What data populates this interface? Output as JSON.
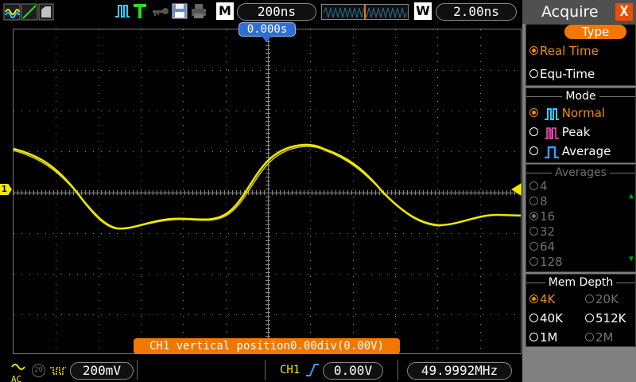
{
  "topbar": {
    "timebase": "200ns",
    "main_label": "M",
    "window_label": "W",
    "window_time": "2.00ns"
  },
  "screen": {
    "trigger_position": "0.000s",
    "ch1_marker": "1",
    "status_message": "CH1 vertical position0.00div(0.00V)",
    "grid": true,
    "colors": {
      "trace": "#f0e800",
      "grid": "#888888",
      "accent": "#f07800"
    }
  },
  "bottombar": {
    "coupling": "AC",
    "bw_limit": "20",
    "volts_div": "200mV",
    "trigger_source": "CH1",
    "trigger_level": "0.00V",
    "frequency": "49.9992MHz"
  },
  "menu": {
    "title": "Acquire",
    "close": "X",
    "type": {
      "title": "Type",
      "options": [
        {
          "label": "Real Time",
          "selected": true
        },
        {
          "label": "Equ-Time",
          "selected": false
        }
      ]
    },
    "mode": {
      "title": "Mode",
      "options": [
        {
          "label": "Normal",
          "selected": true
        },
        {
          "label": "Peak",
          "selected": false
        },
        {
          "label": "Average",
          "selected": false
        }
      ]
    },
    "averages": {
      "title": "Averages",
      "options": [
        "4",
        "8",
        "16",
        "32",
        "64",
        "128"
      ],
      "selected": "16"
    },
    "mem_depth": {
      "title": "Mem Depth",
      "options": [
        "4K",
        "20K",
        "40K",
        "512K",
        "1M",
        "2M"
      ],
      "selected": "4K"
    }
  }
}
